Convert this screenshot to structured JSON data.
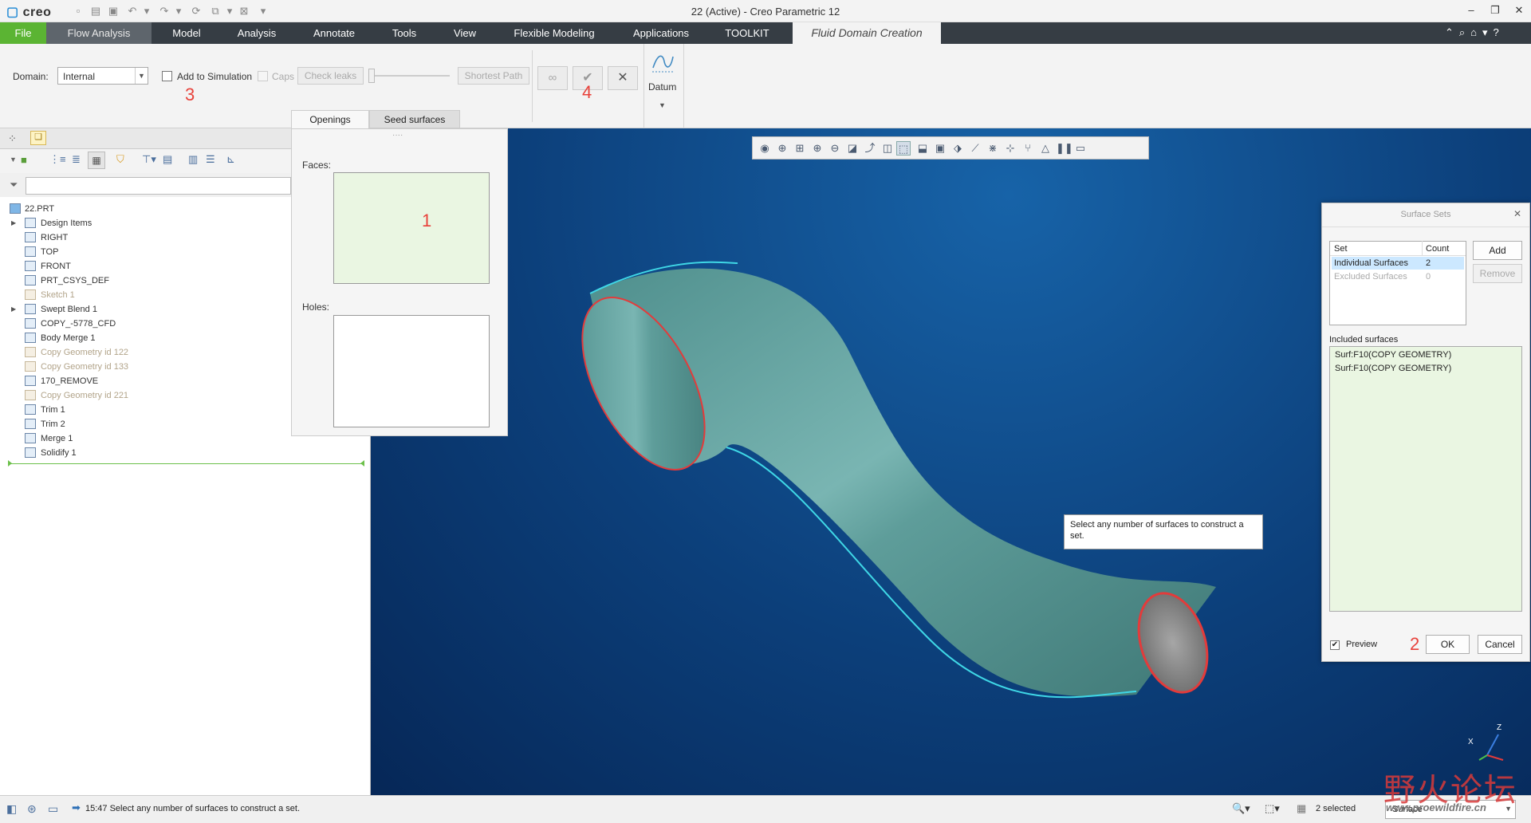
{
  "app": {
    "logo": "creo",
    "window_title": "22 (Active) - Creo Parametric 12"
  },
  "ribbon_tabs": {
    "file": "File",
    "flow_analysis": "Flow Analysis",
    "model": "Model",
    "analysis": "Analysis",
    "annotate": "Annotate",
    "tools": "Tools",
    "view": "View",
    "flexible_modeling": "Flexible Modeling",
    "applications": "Applications",
    "toolkit": "TOOLKIT",
    "fluid_domain": "Fluid Domain Creation"
  },
  "ribbon": {
    "domain_label": "Domain:",
    "domain_value": "Internal",
    "add_to_simulation": "Add to Simulation",
    "add_to_simulation_checked": false,
    "caps": "Caps",
    "check_leaks": "Check leaks",
    "shortest_path": "Shortest Path",
    "datum": "Datum",
    "subtab_openings": "Openings",
    "subtab_seed": "Seed surfaces",
    "annot3": "3",
    "annot4": "4"
  },
  "openings_panel": {
    "faces_label": "Faces:",
    "holes_label": "Holes:",
    "annot1": "1"
  },
  "model_tree": {
    "root": "22.PRT",
    "items": [
      {
        "label": "Design Items",
        "suppressed": false,
        "expandable": true
      },
      {
        "label": "RIGHT",
        "suppressed": false,
        "expandable": false
      },
      {
        "label": "TOP",
        "suppressed": false,
        "expandable": false
      },
      {
        "label": "FRONT",
        "suppressed": false,
        "expandable": false
      },
      {
        "label": "PRT_CSYS_DEF",
        "suppressed": false,
        "expandable": false
      },
      {
        "label": "Sketch 1",
        "suppressed": true,
        "expandable": false
      },
      {
        "label": "Swept Blend 1",
        "suppressed": false,
        "expandable": true
      },
      {
        "label": "COPY_-5778_CFD",
        "suppressed": false,
        "expandable": false
      },
      {
        "label": "Body Merge 1",
        "suppressed": false,
        "expandable": false
      },
      {
        "label": "Copy Geometry id 122",
        "suppressed": true,
        "expandable": false
      },
      {
        "label": "Copy Geometry id 133",
        "suppressed": true,
        "expandable": false
      },
      {
        "label": "170_REMOVE",
        "suppressed": false,
        "expandable": false
      },
      {
        "label": "Copy Geometry id 221",
        "suppressed": true,
        "expandable": false
      },
      {
        "label": "Trim 1",
        "suppressed": false,
        "expandable": false
      },
      {
        "label": "Trim 2",
        "suppressed": false,
        "expandable": false
      },
      {
        "label": "Merge 1",
        "suppressed": false,
        "expandable": false
      },
      {
        "label": "Solidify 1",
        "suppressed": false,
        "expandable": false
      }
    ]
  },
  "surface_sets": {
    "title": "Surface Sets",
    "col_set": "Set",
    "col_count": "Count",
    "rows": [
      {
        "set": "Individual Surfaces",
        "count": "2"
      },
      {
        "set": "Excluded Surfaces",
        "count": "0"
      }
    ],
    "add": "Add",
    "remove": "Remove",
    "included_label": "Included surfaces",
    "included": [
      "Surf:F10(COPY GEOMETRY)",
      "Surf:F10(COPY GEOMETRY)"
    ],
    "preview": "Preview",
    "preview_checked": true,
    "ok": "OK",
    "cancel": "Cancel",
    "annot2": "2"
  },
  "tooltip": "Select any number of surfaces to construct a set.",
  "status": {
    "message": "15:47 Select any number of surfaces to construct a set.",
    "selected": "2 selected",
    "filter": "Surface"
  },
  "watermark": {
    "text": "野火论坛",
    "url": "www.proewildfire.cn"
  },
  "colors": {
    "file_tab": "#5bb433",
    "ribbon_dark": "#363d44",
    "viewport": "#0c3f7a",
    "pipe": "#5a9c9a",
    "annotation": "#e8423b",
    "list_green": "#eaf6e2",
    "selection_blue": "#cce8ff"
  }
}
